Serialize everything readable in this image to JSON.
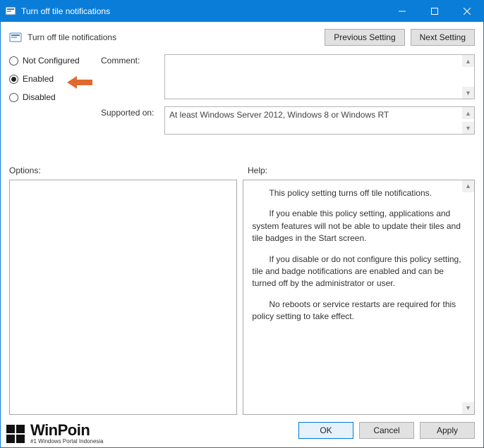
{
  "titlebar": {
    "title": "Turn off tile notifications"
  },
  "setting": {
    "icon_name": "policy-setting-icon",
    "title": "Turn off tile notifications"
  },
  "nav": {
    "previous": "Previous Setting",
    "next": "Next Setting"
  },
  "radios": {
    "not_configured": "Not Configured",
    "enabled": "Enabled",
    "disabled": "Disabled",
    "selected": "enabled"
  },
  "labels": {
    "comment": "Comment:",
    "supported_on": "Supported on:",
    "options": "Options:",
    "help": "Help:"
  },
  "comment": "",
  "supported_on": "At least Windows Server 2012, Windows 8 or Windows RT",
  "help_paragraphs": [
    "This policy setting turns off tile notifications.",
    "If you enable this policy setting, applications and system features will not be able to update their tiles and tile badges in the Start screen.",
    "If you disable or do not configure this policy setting, tile and badge notifications are enabled and can be turned off by the administrator or user.",
    "No reboots or service restarts are required for this policy setting to take effect."
  ],
  "buttons": {
    "ok": "OK",
    "cancel": "Cancel",
    "apply": "Apply"
  },
  "watermark": {
    "title": "WinPoin",
    "subtitle": "#1 Windows Portal Indonesia"
  }
}
